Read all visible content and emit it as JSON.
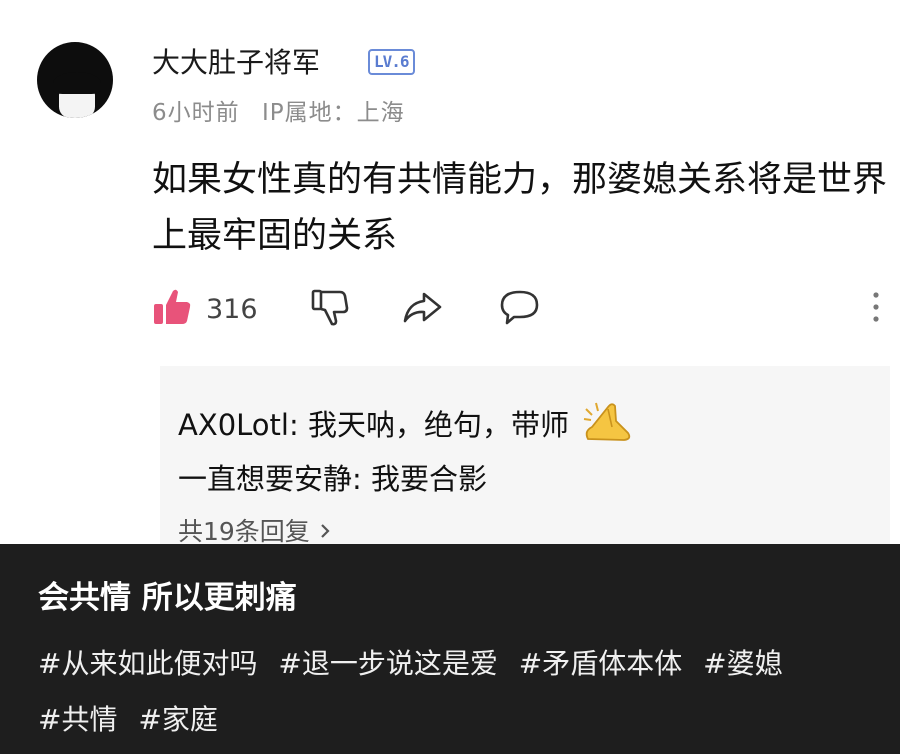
{
  "comment": {
    "username": "大大肚子将军",
    "level_badge": "LV.6",
    "time_ago": "6小时前",
    "ip_location": "IP属地：上海",
    "text": "如果女性真的有共情能力，那婆媳关系将是世界上最牢固的关系",
    "likes": "316",
    "icons": [
      "thumbs-up-icon",
      "thumbs-down-icon",
      "share-icon",
      "comment-icon",
      "more-vertical-icon"
    ]
  },
  "replies": {
    "items": [
      {
        "author": "AX0Lotl",
        "text": "我天呐，绝句，带师"
      },
      {
        "author": "一直想要安静",
        "text": "我要合影"
      }
    ],
    "more_label": "共19条回复",
    "emoji": "folded-hand-emoji"
  },
  "caption": {
    "title": "会共情 所以更刺痛",
    "tags": [
      "#从来如此便对吗",
      "#退一步说这是爱",
      "#矛盾体本体",
      "#婆媳",
      "#共情",
      "#家庭"
    ]
  },
  "colors": {
    "like_pink": "#e8537a",
    "badge_blue": "#5a7cd0",
    "meta_gray": "#8c8c8c",
    "reply_bg": "#f6f6f6",
    "caption_bg": "#1e1e1e"
  }
}
